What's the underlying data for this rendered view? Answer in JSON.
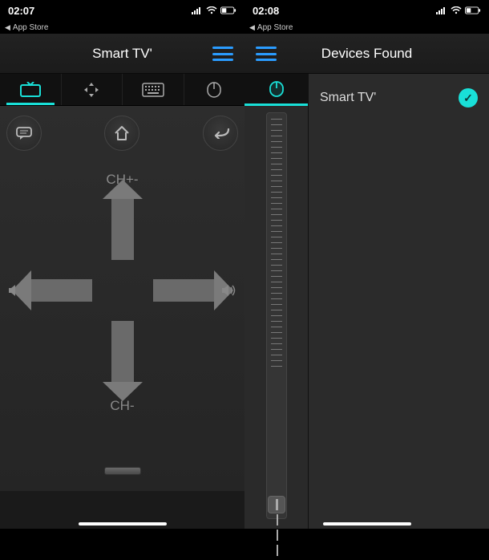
{
  "colors": {
    "accent": "#19e0d8",
    "menu": "#2a9cff"
  },
  "left": {
    "status": {
      "time": "02:07",
      "back_label": "App Store"
    },
    "header": {
      "title": "Smart TV'"
    },
    "tabs": [
      {
        "id": "tv",
        "icon": "tv-icon",
        "active": true
      },
      {
        "id": "move",
        "icon": "move-icon",
        "active": false
      },
      {
        "id": "keyboard",
        "icon": "keyboard-icon",
        "active": false
      },
      {
        "id": "mouse",
        "icon": "touchpad-icon",
        "active": false
      }
    ],
    "buttons": {
      "chat": "chat",
      "home": "home",
      "back": "back"
    },
    "dpad": {
      "up_label": "CH+-",
      "down_label": "CH-",
      "left_icon": "speaker-mute-icon",
      "right_icon": "speaker-loud-icon"
    }
  },
  "right": {
    "status": {
      "time": "02:08",
      "back_label": "App Store"
    },
    "header": {
      "title": "Devices Found"
    },
    "mouse_tab": {
      "icon": "mouse-icon"
    },
    "devices": [
      {
        "name": "Smart TV'",
        "selected": true
      }
    ]
  }
}
